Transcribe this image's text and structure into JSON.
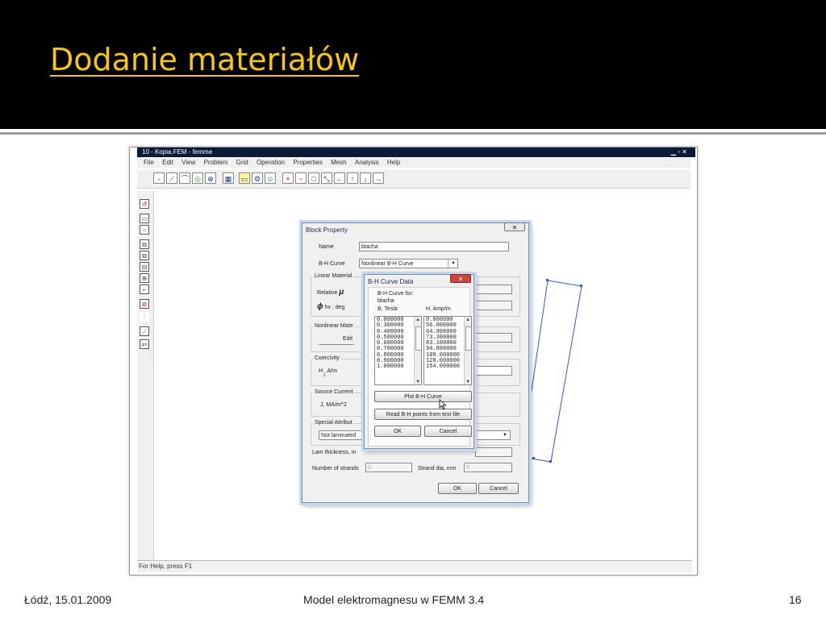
{
  "slide": {
    "title": "Dodanie materiałów",
    "footer_left": "Łódź, 15.01.2009",
    "footer_center": "Model elektromagnesu w FEMM 3.4",
    "footer_right": "16"
  },
  "app": {
    "title": "10 - Kopia.FEM - femme",
    "menu": [
      "File",
      "Edit",
      "View",
      "Problem",
      "Grid",
      "Operation",
      "Properties",
      "Mesh",
      "Analysis",
      "Help"
    ],
    "status": "For Help, press F1"
  },
  "block_property": {
    "title": "Block Property",
    "close": "✕",
    "name_label": "Name",
    "name_value": "blacha",
    "bh_label": "B-H Curve",
    "bh_value": "Nonlinear B-H Curve",
    "linear_group": "Linear Material",
    "relative_label": "Relative",
    "phi_label": "hx , deg",
    "nonlinear_group": "Nonlinear Mate",
    "edit_btn": "Edit",
    "coercivity_group": "Coercivity",
    "hc_label": "H , A/m",
    "hc_sub": "c",
    "source_group": "Source Current",
    "j_label": "J, MA/m^2",
    "special_group": "Special Attribut",
    "lam_value": "Not laminated",
    "lam_thickness_label": "Lam thickness, m",
    "strands_label": "Number of strands",
    "strands_value": "0",
    "strand_dia_label": "Strand dia, mm",
    "strand_dia_value": "0",
    "ok": "OK",
    "cancel": "Cancel"
  },
  "bh_dialog": {
    "title": "B-H Curve Data",
    "close": "✕",
    "for_label": "B-H Curve for:",
    "for_value": "blacha",
    "b_header": "B, Tesla",
    "h_header": "H, Amp/m",
    "b_values": [
      "0.000000",
      "0.300000",
      "0.400000",
      "0.500000",
      "0.600000",
      "0.700000",
      "0.800000",
      "0.900000",
      "1.000000"
    ],
    "h_values": [
      "0.000000",
      "56.800000",
      "64.900000",
      "73.300000",
      "83.100000",
      "94.800000",
      "109.000000",
      "128.000000",
      "154.000000"
    ],
    "plot_btn": "Plot B-H Curve",
    "read_btn": "Read B-H points from text file",
    "ok": "OK",
    "cancel": "Cancel"
  }
}
